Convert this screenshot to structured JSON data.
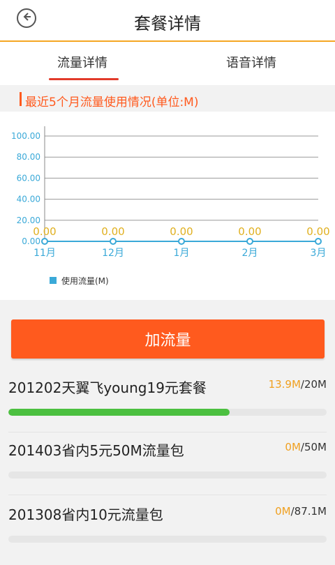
{
  "header": {
    "title": "套餐详情"
  },
  "tabs": [
    {
      "label": "流量详情",
      "active": true
    },
    {
      "label": "语音详情",
      "active": false
    }
  ],
  "section_title": "最近5个月流量使用情况(单位:M)",
  "chart_data": {
    "type": "line",
    "categories": [
      "11月",
      "12月",
      "1月",
      "2月",
      "3月"
    ],
    "series": [
      {
        "name": "使用流量(M)",
        "values": [
          0,
          0,
          0,
          0,
          0
        ],
        "color": "#3aa9d8"
      }
    ],
    "data_labels": [
      "0.00",
      "0.00",
      "0.00",
      "0.00",
      "0.00"
    ],
    "y_ticks": [
      "0.00",
      "20.00",
      "40.00",
      "60.00",
      "80.00",
      "100.00"
    ],
    "ylim": [
      0,
      100
    ],
    "grid": true,
    "legend_position": "bottom-left"
  },
  "add_button_label": "加流量",
  "packages": [
    {
      "name": "201202天翼飞young19元套餐",
      "used": "13.9M",
      "total": "/20M",
      "fraction": 0.695
    },
    {
      "name": "201403省内5元50M流量包",
      "used": "0M",
      "total": "/50M",
      "fraction": 0
    },
    {
      "name": "201308省内10元流量包",
      "used": "0M",
      "total": "/87.1M",
      "fraction": 0
    }
  ],
  "colors": {
    "accent": "#ff5a1e",
    "header_line": "#f5a623",
    "tab_underline": "#e23b2a",
    "progress": "#4cc040",
    "chart_line": "#3aa9d8",
    "data_label": "#e0b020"
  },
  "icons": {
    "back": "back-arrow-icon"
  }
}
